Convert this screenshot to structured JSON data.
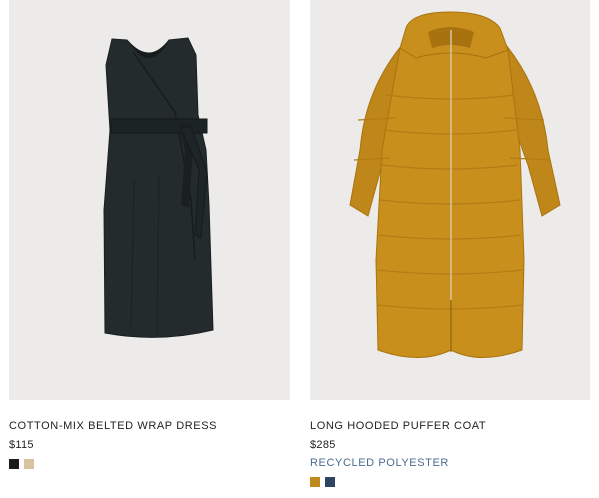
{
  "products": [
    {
      "name": "COTTON-MIX BELTED WRAP DRESS",
      "price": "$115",
      "tag": "",
      "image_icon": "dress-image",
      "swatches": [
        {
          "name": "black",
          "color": "#1b1b1b"
        },
        {
          "name": "beige",
          "color": "#d8c3a0"
        }
      ]
    },
    {
      "name": "LONG HOODED PUFFER COAT",
      "price": "$285",
      "tag": "RECYCLED POLYESTER",
      "image_icon": "puffer-coat-image",
      "swatches": [
        {
          "name": "mustard",
          "color": "#c08a1e"
        },
        {
          "name": "navy",
          "color": "#2f4463"
        }
      ]
    }
  ],
  "colors": {
    "image_background": "#ecebe9",
    "dress": "#232b2d",
    "coat": "#c98f1d",
    "tag_text": "#4a6b8f"
  }
}
